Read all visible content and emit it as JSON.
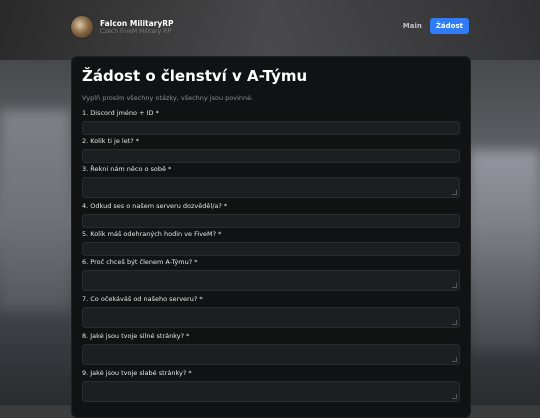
{
  "brand": {
    "name": "Falcon MilitaryRP",
    "tagline": "Czech FiveM Military RP"
  },
  "nav": {
    "main_label": "Main",
    "apply_label": "Žádost"
  },
  "form": {
    "title": "Žádost o členství v A-Týmu",
    "intro": "Vyplň prosím všechny otázky, všechny jsou povinné.",
    "questions": [
      {
        "label": "1. Discord jméno + ID *",
        "type": "short"
      },
      {
        "label": "2. Kolik ti je let? *",
        "type": "short"
      },
      {
        "label": "3. Řekni nám něco o sobě *",
        "type": "tall"
      },
      {
        "label": "4. Odkud ses o našem serveru dozvěděl/a? *",
        "type": "short"
      },
      {
        "label": "5. Kolik máš odehraných hodin ve FiveM? *",
        "type": "short"
      },
      {
        "label": "6. Proč chceš být členem A-Týmu? *",
        "type": "tall"
      },
      {
        "label": "7. Co očekáváš od našeho serveru? *",
        "type": "tall"
      },
      {
        "label": "8. Jaké jsou tvoje silné stránky? *",
        "type": "tall"
      },
      {
        "label": "9. Jaké jsou tvoje slabé stránky? *",
        "type": "tall"
      }
    ]
  },
  "colors": {
    "accent": "#2f7cf6",
    "card_bg": "#111214",
    "field_bg": "#1d1e21"
  }
}
